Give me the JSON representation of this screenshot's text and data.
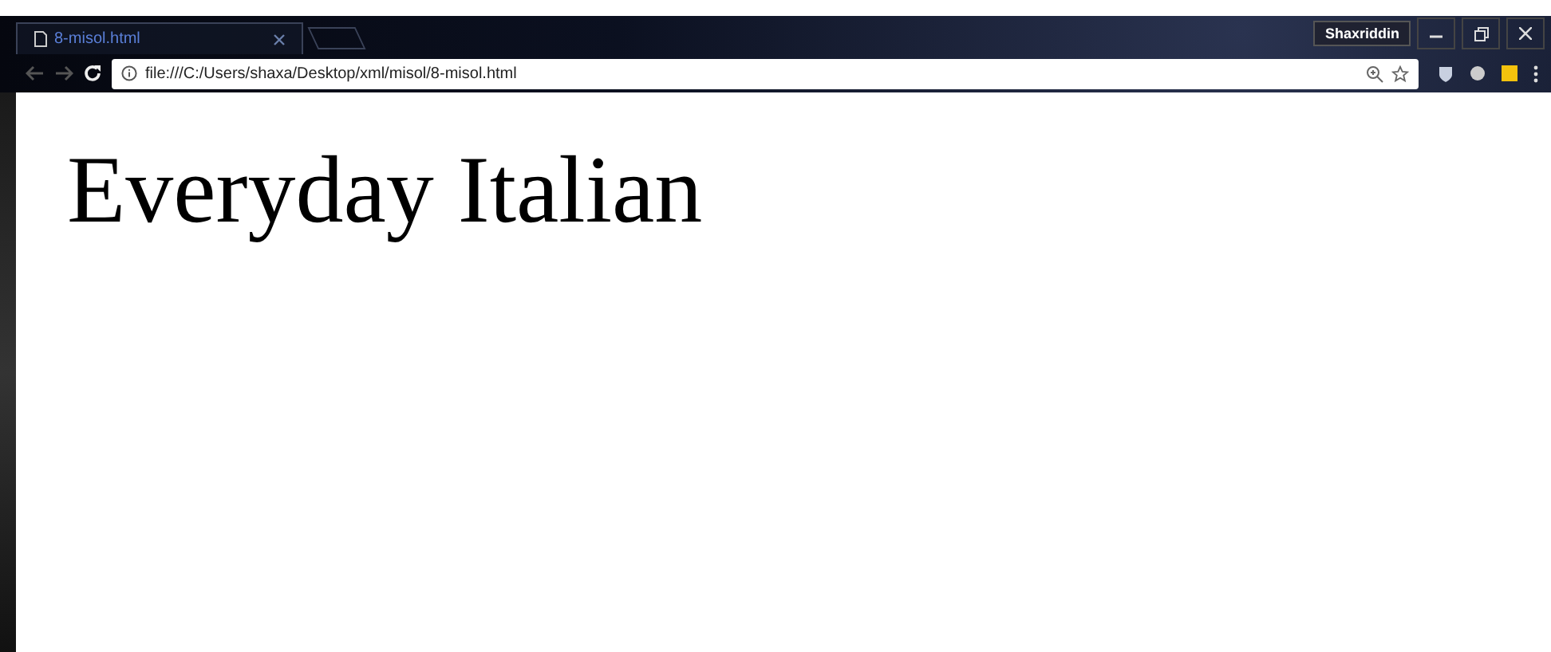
{
  "tab": {
    "title": "8-misol.html",
    "selected": true
  },
  "profile": {
    "name": "Shaxriddin"
  },
  "address_bar": {
    "value": "file:///C:/Users/shaxa/Desktop/xml/misol/8-misol.html"
  },
  "page": {
    "heading": "Everyday Italian"
  }
}
